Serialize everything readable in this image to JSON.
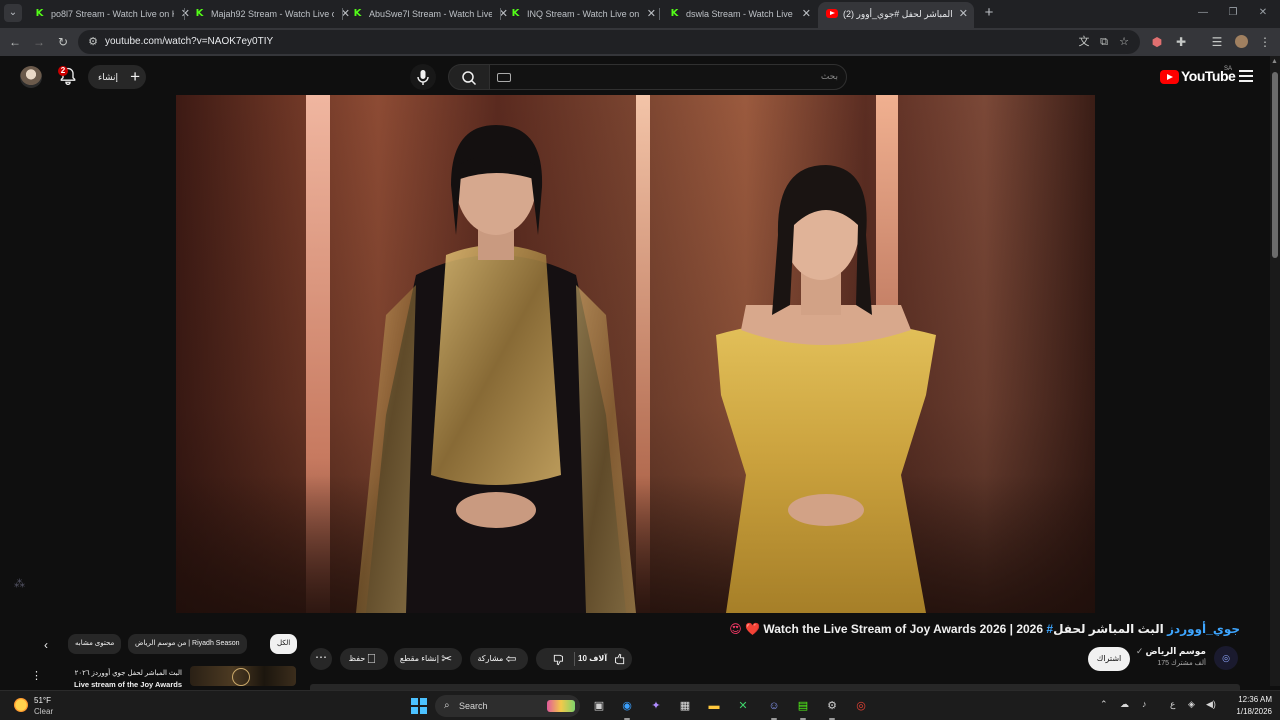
{
  "browser": {
    "tabs": [
      {
        "title": "po8l7 Stream - Watch Live on Kick",
        "favicon": "kick-icon"
      },
      {
        "title": "Majah92 Stream - Watch Live on Kick",
        "favicon": "kick-icon"
      },
      {
        "title": "AbuSwe7l Stream - Watch Live on Kick",
        "favicon": "kick-icon"
      },
      {
        "title": "INQ Stream - Watch Live on Kick",
        "favicon": "kick-icon"
      },
      {
        "title": "dswla Stream - Watch Live on Kick",
        "favicon": "kick-icon"
      },
      {
        "title": "(2) البث المباشر لحفل #جوي_أوور",
        "favicon": "youtube-icon",
        "active": true
      }
    ],
    "url": "youtube.com/watch?v=NAOK7ey0TIY"
  },
  "youtube": {
    "notification_count": "2",
    "create_label": "إنشاء",
    "search_placeholder": "بحث",
    "logo_text": "YouTube",
    "logo_country": "SA",
    "video": {
      "title_ar": "البث المباشر لحفل",
      "hashtag": "#جوي_أووردز",
      "title_en": "Watch the Live Stream of Joy Awards 2026 | 2026",
      "emojis": "😍 ❤️"
    },
    "channel": {
      "name": "موسم الرياض",
      "verified": "✓",
      "subscribers": "175 ألف مشترك",
      "subscribe_label": "اشتراك"
    },
    "actions": {
      "likes": "10 آلاف",
      "share": "مشاركة",
      "clip": "إنشاء مقطع",
      "save": "حفظ",
      "more": "⋯"
    },
    "chips": [
      {
        "label": "الكل",
        "selected": true
      },
      {
        "label": "من موسم الرياض | Riyadh Season",
        "selected": false
      },
      {
        "label": "محتوى مشابه",
        "selected": false
      }
    ],
    "related": {
      "title_ar": "البث المباشر لحفل جوي أووردز ٢٠٢٦",
      "title_en": "Live stream of the  Joy Awards"
    }
  },
  "taskbar": {
    "weather_temp": "51°F",
    "weather_cond": "Clear",
    "search_label": "Search",
    "lang": "ع",
    "time": "12:36 AM",
    "date": "1/18/2026"
  }
}
